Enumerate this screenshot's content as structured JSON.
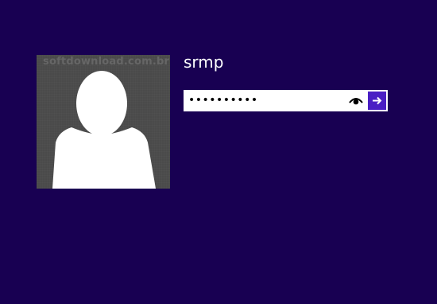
{
  "user": {
    "name": "srmp",
    "avatar_icon": "user-silhouette-icon",
    "watermark": "softdownload.com.br"
  },
  "password": {
    "masked_value": "••••••••••",
    "reveal_icon": "eye-icon",
    "submit_icon": "arrow-right-icon"
  },
  "colors": {
    "background": "#180052",
    "avatar_bg": "#4a4a4a",
    "submit_bg": "#4a1fc4"
  }
}
